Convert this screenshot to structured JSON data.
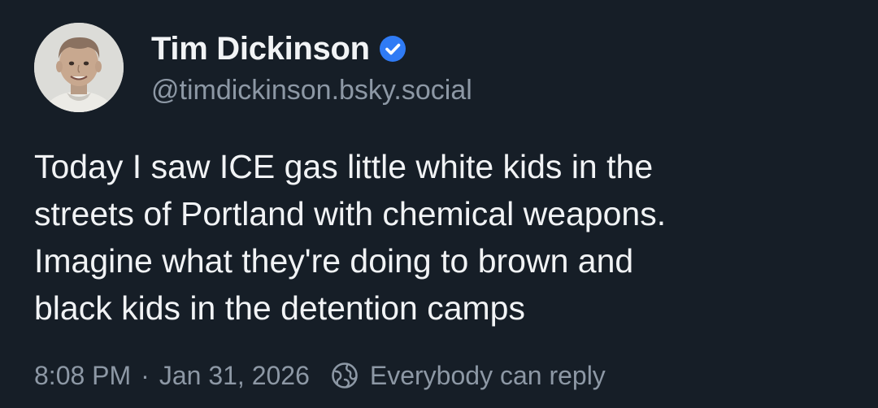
{
  "post": {
    "author": {
      "display_name": "Tim Dickinson",
      "handle": "@timdickinson.bsky.social",
      "verified": true,
      "avatar_icon": "avatar-photo"
    },
    "text_lines": [
      "Today I saw ICE gas little white kids in the",
      "streets of Portland with chemical weapons.",
      "Imagine what they're doing to brown and",
      "black kids in the detention camps"
    ],
    "time": "8:08 PM",
    "separator": "·",
    "date": "Jan 31, 2026",
    "reply_setting": "Everybody can reply",
    "reply_icon": "globe-icon"
  },
  "colors": {
    "background": "#161e27",
    "text": "#f1f3f5",
    "muted": "#8d98a5",
    "verified_badge": "#2f7bf5"
  }
}
